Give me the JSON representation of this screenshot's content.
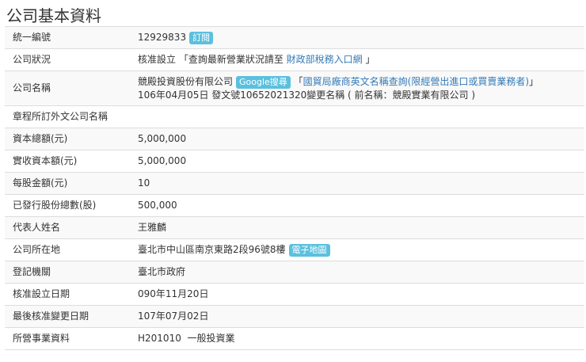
{
  "title": "公司基本資料",
  "rows": [
    {
      "label": "統一編號",
      "value": "12929833",
      "badge": "訂閱"
    },
    {
      "label": "公司狀況",
      "value": "核准設立 「查詢最新營業狀況請至",
      "link": "財政部稅務入口網",
      "suffix": " 」"
    },
    {
      "label": "公司名稱",
      "value": "競殿投資股份有限公司",
      "badge": "Google搜尋",
      "link_prefix": "「",
      "link": "國貿局廠商英文名稱查詢(限經營出進口或買賣業務者)",
      "suffix": "」",
      "line2": "106年04月05日 發文號10652021320變更名稱 ( 前名稱：競殿實業有限公司 )"
    },
    {
      "label": "章程所訂外文公司名稱",
      "value": ""
    },
    {
      "label": "資本總額(元)",
      "value": "5,000,000"
    },
    {
      "label": "實收資本額(元)",
      "value": "5,000,000"
    },
    {
      "label": "每股金額(元)",
      "value": "10"
    },
    {
      "label": "已發行股份總數(股)",
      "value": "500,000"
    },
    {
      "label": "代表人姓名",
      "value": "王雅麟"
    },
    {
      "label": "公司所在地",
      "value": "臺北市中山區南京東路2段96號8樓",
      "badge": "電子地圖"
    },
    {
      "label": "登記機關",
      "value": "臺北市政府"
    },
    {
      "label": "核准設立日期",
      "value": "090年11月20日"
    },
    {
      "label": "最後核准變更日期",
      "value": "107年07月02日"
    },
    {
      "label": "所營事業資料",
      "value": "H201010  一般投資業"
    }
  ]
}
